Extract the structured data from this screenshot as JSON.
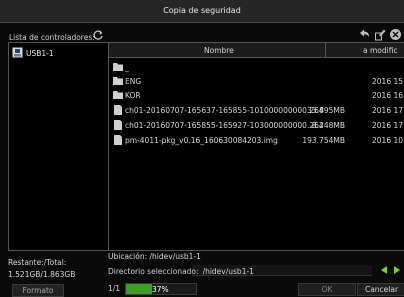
{
  "window": {
    "title": "Copia de seguridad"
  },
  "controllers": {
    "label": "Lista de controladores:",
    "items": [
      {
        "label": "USB1-1",
        "selected": true
      }
    ]
  },
  "toolbar_icons": [
    "back-icon",
    "edit-icon",
    "close-icon"
  ],
  "file_list": {
    "columns": {
      "name": "Nombre",
      "modified": "a modific"
    },
    "rows": [
      {
        "type": "folder",
        "name": "_",
        "size": "",
        "date": ""
      },
      {
        "type": "folder",
        "name": "ENG",
        "size": "",
        "date": "2016 15"
      },
      {
        "type": "folder",
        "name": "KOR",
        "size": "",
        "date": "2016 16"
      },
      {
        "type": "file",
        "name": "ch01-20160707-165637-165855-101000000000.264",
        "size": "33.895MB",
        "date": "2016 17"
      },
      {
        "type": "file",
        "name": "ch01-20160707-165855-165927-103000000000.264",
        "size": "8.248MB",
        "date": "2016 17"
      },
      {
        "type": "file",
        "name": "pm-4011-pkg_v0.16_160630084203.img",
        "size": "193.754MB",
        "date": "2016 10"
      }
    ]
  },
  "storage": {
    "label": "Restante:/Total:",
    "value": "1.521GB/1.863GB"
  },
  "location": {
    "text": "Ubicación: /hidev/usb1-1"
  },
  "selected_dir": {
    "label": "Directorio seleccionado:",
    "value": "/hidev/usb1-1"
  },
  "buttons": {
    "format": "Formato",
    "ok": "OK",
    "cancel": "Cancelar"
  },
  "page": {
    "text": "1/1"
  },
  "progress": {
    "percent": 37,
    "text": "37%"
  },
  "colors": {
    "accent_green": "#7fcf2a",
    "progress_fill": "#3a9f1e"
  }
}
